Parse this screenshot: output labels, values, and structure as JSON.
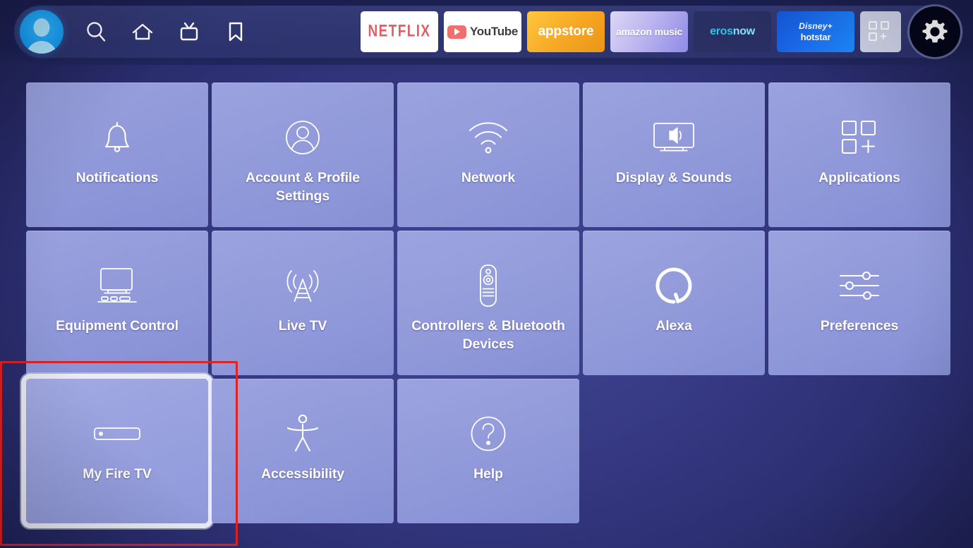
{
  "topbar": {
    "avatar_label": "profile-avatar",
    "nav_icons": [
      {
        "name": "search-icon",
        "label": "Search"
      },
      {
        "name": "home-icon",
        "label": "Home"
      },
      {
        "name": "live-tv-icon",
        "label": "Live TV"
      },
      {
        "name": "bookmark-icon",
        "label": "Watchlist"
      }
    ],
    "apps": [
      {
        "name": "netflix",
        "label": "NETFLIX"
      },
      {
        "name": "youtube",
        "label": "YouTube"
      },
      {
        "name": "appstore",
        "label": "appstore"
      },
      {
        "name": "amazon-music",
        "label": "amazon music"
      },
      {
        "name": "erosnow",
        "label_a": "eros",
        "label_b": "now"
      },
      {
        "name": "hotstar",
        "label_a": "Disney+",
        "label_b": "hotstar"
      },
      {
        "name": "all-apps",
        "label": ""
      }
    ],
    "settings_gear_label": "Settings"
  },
  "grid": {
    "rows": [
      [
        {
          "id": "notifications",
          "label": "Notifications",
          "icon": "bell-icon",
          "selected": false
        },
        {
          "id": "account-profile-settings",
          "label": "Account & Profile Settings",
          "icon": "person-circle-icon",
          "selected": false
        },
        {
          "id": "network",
          "label": "Network",
          "icon": "wifi-icon",
          "selected": false
        },
        {
          "id": "display-and-sounds",
          "label": "Display & Sounds",
          "icon": "tv-sound-icon",
          "selected": false
        },
        {
          "id": "applications",
          "label": "Applications",
          "icon": "apps-grid-icon",
          "selected": false
        }
      ],
      [
        {
          "id": "equipment-control",
          "label": "Equipment Control",
          "icon": "monitor-keyboard-icon",
          "selected": false
        },
        {
          "id": "live-tv",
          "label": "Live TV",
          "icon": "antenna-icon",
          "selected": false
        },
        {
          "id": "controllers-bluetooth-devices",
          "label": "Controllers & Bluetooth Devices",
          "icon": "remote-control-icon",
          "selected": false
        },
        {
          "id": "alexa",
          "label": "Alexa",
          "icon": "alexa-ring-icon",
          "selected": false
        },
        {
          "id": "preferences",
          "label": "Preferences",
          "icon": "sliders-icon",
          "selected": false
        }
      ],
      [
        {
          "id": "my-fire-tv",
          "label": "My Fire TV",
          "icon": "fire-tv-stick-icon",
          "selected": true
        },
        {
          "id": "accessibility",
          "label": "Accessibility",
          "icon": "accessibility-icon",
          "selected": false
        },
        {
          "id": "help",
          "label": "Help",
          "icon": "question-circle-icon",
          "selected": false
        }
      ]
    ]
  },
  "annotation": {
    "target": "my-fire-tv",
    "color": "#e02020"
  },
  "colors": {
    "background": "#343781",
    "tile": "#939bdb",
    "tile_text": "#ffffff",
    "selection_ring": "#e9ebf6",
    "annotation_red": "#e02020",
    "avatar_blue": "#179ef5"
  }
}
